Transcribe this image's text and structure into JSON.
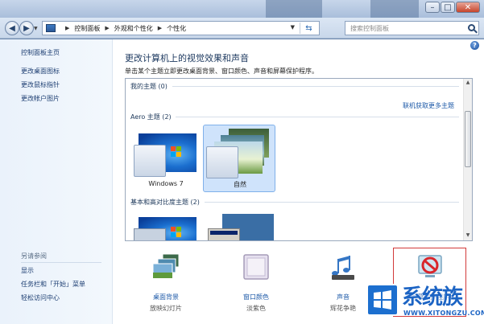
{
  "address": {
    "crumbs": [
      "控制面板",
      "外观和个性化",
      "个性化"
    ],
    "search_placeholder": "搜索控制面板"
  },
  "left_pane": {
    "links": [
      "控制面板主页",
      "更改桌面图标",
      "更改鼠标指针",
      "更改帐户图片"
    ],
    "see_also_title": "另请参阅",
    "see_also_links": [
      "显示",
      "任务栏和「开始」菜单",
      "轻松访问中心"
    ]
  },
  "main": {
    "title": "更改计算机上的视觉效果和声音",
    "subtitle": "单击某个主题立即更改桌面背景、窗口颜色、声音和屏幕保护程序。",
    "groups": {
      "my_themes": "我的主题 (0)",
      "online_link": "联机获取更多主题",
      "aero": "Aero 主题 (2)",
      "basic": "基本和高对比度主题 (2)"
    },
    "aero_themes": [
      "Windows 7",
      "自然"
    ]
  },
  "bottom": [
    {
      "title": "桌面背景",
      "sub": "放映幻灯片"
    },
    {
      "title": "窗口颜色",
      "sub": "淡紫色"
    },
    {
      "title": "声音",
      "sub": "辉花争艳"
    },
    {
      "title": "屏幕保护程序",
      "sub": ""
    }
  ],
  "watermark": {
    "text": "系统族",
    "url": "WWW.XITONGZU.COM"
  },
  "colors": {
    "link": "#1e5aa8",
    "accent": "#1c6fcf"
  }
}
